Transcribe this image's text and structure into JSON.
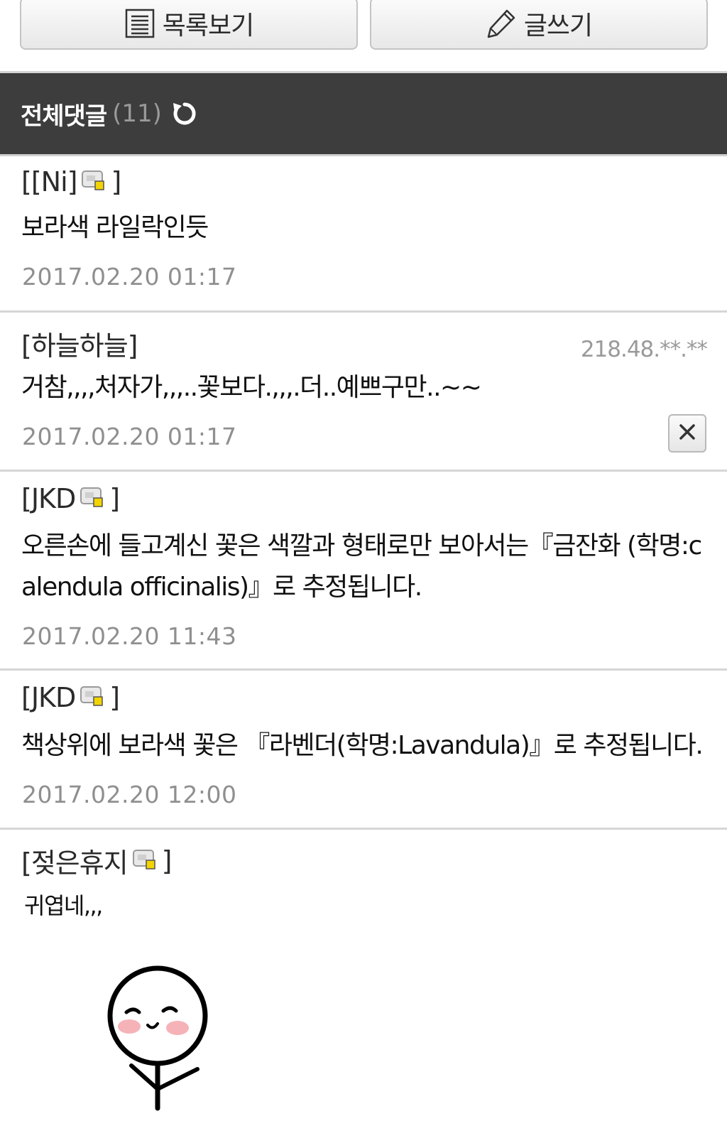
{
  "toolbar": {
    "list_label": "목록보기",
    "list_icon": "list-icon",
    "write_label": "글쓰기",
    "write_icon": "pencil-icon"
  },
  "comments_header": {
    "title": "전체댓글",
    "count": "(11)",
    "refresh_icon": "refresh-icon"
  },
  "comments": [
    {
      "author": "[[Ni]",
      "author_close": "]",
      "badge_icon": "member-badge-icon",
      "text": "보라색 라일락인듯",
      "date": "2017.02.20 01:17"
    },
    {
      "author": "[하늘하늘]",
      "ip": "218.48.**.**",
      "text": "거참,,,,처자가,,,..꽃보다.,,,.더..예쁘구만..~~",
      "date": "2017.02.20 01:17",
      "delete_icon": "close-icon"
    },
    {
      "author": "[JKD",
      "author_close": "]",
      "badge_icon": "member-badge-icon",
      "text_line1": "오른손에 들고계신 꽃은 색깔과 형태로만 보아서는『금잔화 (학명:c",
      "text_line2": "alendula officinalis)』로 추정됩니다.",
      "date": "2017.02.20 11:43"
    },
    {
      "author": "[JKD",
      "author_close": "]",
      "badge_icon": "member-badge-icon",
      "text": "책상위에 보라색 꽃은 『라벤더(학명:Lavandula)』로 추정됩니다.",
      "date": "2017.02.20 12:00"
    },
    {
      "author": "[젖은휴지",
      "author_close": "]",
      "badge_icon": "member-badge-icon",
      "text": "귀엽네,,,",
      "sticker": "smiling-stick-figure"
    }
  ]
}
